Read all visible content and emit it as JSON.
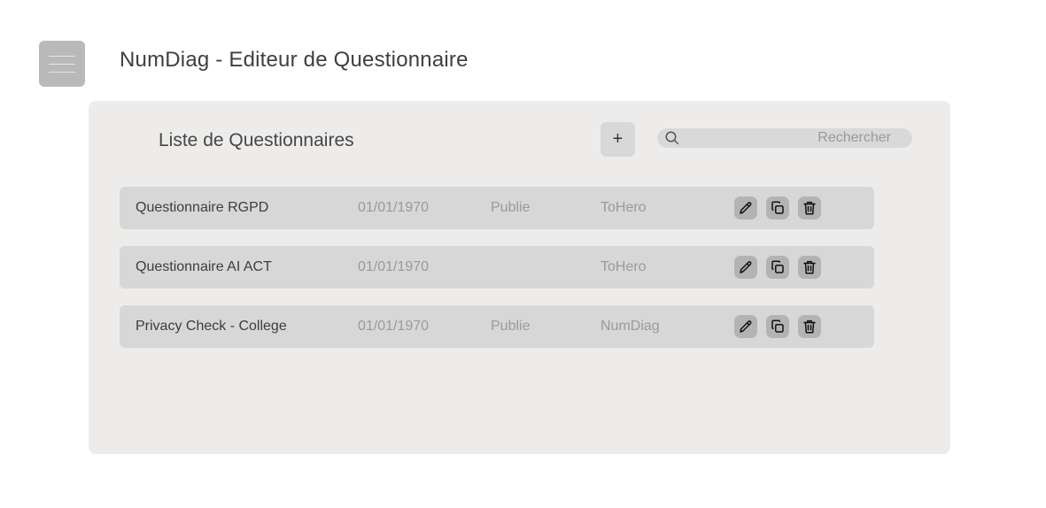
{
  "app": {
    "title": "NumDiag - Editeur de Questionnaire"
  },
  "panel": {
    "title": "Liste de Questionnaires",
    "add_label": "+",
    "search": {
      "placeholder": "Rechercher",
      "value": ""
    }
  },
  "questionnaires": [
    {
      "name": "Questionnaire RGPD",
      "date": "01/01/1970",
      "status": "Publie",
      "owner": "ToHero"
    },
    {
      "name": "Questionnaire AI ACT",
      "date": "01/01/1970",
      "status": "",
      "owner": "ToHero"
    },
    {
      "name": "Privacy Check - College",
      "date": "01/01/1970",
      "status": "Publie",
      "owner": "NumDiag"
    }
  ],
  "icons": {
    "menu": "hamburger-menu-icon",
    "search": "search-icon",
    "edit": "pencil-icon",
    "duplicate": "copy-icon",
    "delete": "trash-icon"
  },
  "colors": {
    "panel_bg": "#edeceb",
    "row_bg": "#d7d7d7",
    "action_bg": "#b3b3b3",
    "menu_bg": "#b9b9b9"
  }
}
